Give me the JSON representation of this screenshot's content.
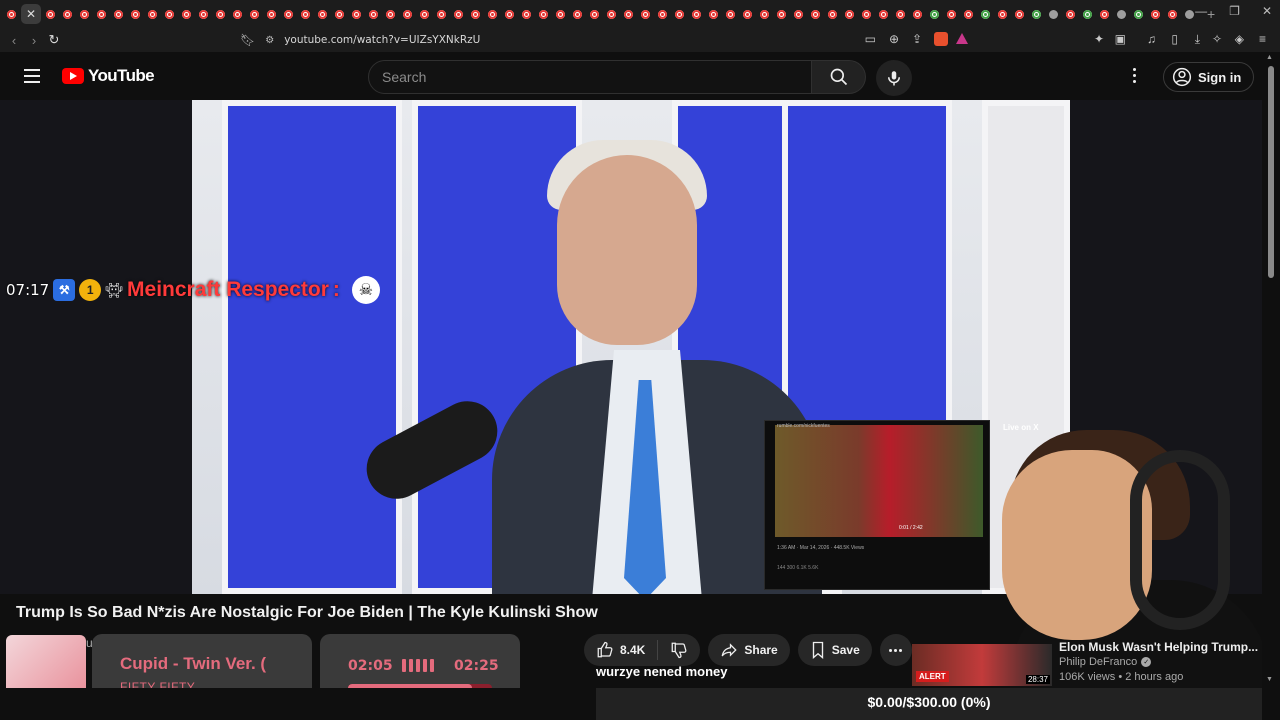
{
  "browser": {
    "url": "youtube.com/watch?v=UIZsYXNkRzU",
    "tab_count": 70
  },
  "youtube": {
    "logo_text": "YouTube",
    "search_placeholder": "Search",
    "signin_label": "Sign in"
  },
  "overlay_chat": {
    "time": "07:17",
    "sub_badge": "1",
    "username": "Meincraft Respector",
    "separator": ":"
  },
  "embed": {
    "url_text": "rumble.com/nickfuentes",
    "meta": "1:36 AM · Mar 14, 2026 · 448.5K Views",
    "stats": "144   300   6.1K   5.6K",
    "player_time": "0:01 / 2:42",
    "live_label": "Live on X"
  },
  "video": {
    "title": "Trump Is So Bad N*zis Are Nostalgic For Joe Biden | The Kyle Kulinski Show",
    "channel_peek": "ul",
    "likes": "8.4K",
    "share_label": "Share",
    "save_label": "Save",
    "caption": "wurzye nened money"
  },
  "now_playing": {
    "title": "Cupid - Twin Ver. (",
    "artist": "FIFTY FIFTY",
    "current_time": "02:05",
    "total_time": "02:25",
    "progress": 0.86
  },
  "suggestion": {
    "title": "Elon Musk Wasn't Helping Trump...",
    "channel": "Philip DeFranco",
    "views": "106K views",
    "age": "2 hours ago",
    "alert": "ALERT",
    "duration": "28:37"
  },
  "goal": {
    "text": "$0.00/$300.00 (0%)"
  },
  "colors": {
    "brand_red": "#ff0000",
    "now_playing_accent": "#e46b7d",
    "background": "#0f0f0f"
  }
}
